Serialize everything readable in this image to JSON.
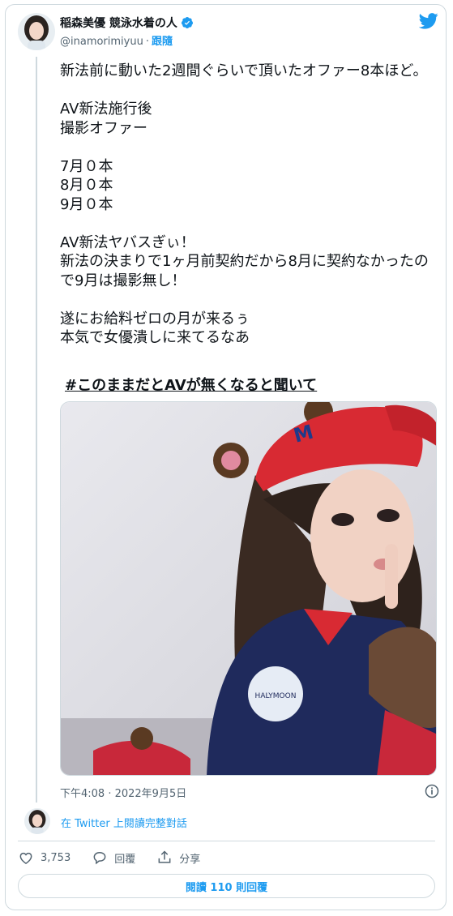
{
  "author": {
    "display_name": "稲森美優 競泳水着の人",
    "handle": "@inamorimiyuu",
    "separator": "·",
    "follow_label": "跟隨"
  },
  "tweet": {
    "text": "新法前に動いた2週間ぐらいで頂いたオファー8本ほど。\n\nAV新法施行後\n撮影オファー\n\n7月０本\n8月０本\n9月０本\n\nAV新法ヤバスぎぃ！\n新法の決まりで1ヶ月前契約だから8月に契約なかったので9月は撮影無し！\n\n遂にお給料ゼロの月が来るぅ\n本気で女優潰しに来てるなあ",
    "hashtag": "#このままだとAVが無くなると聞いて",
    "timestamp": "下午4:08 · 2022年9月5日"
  },
  "thread_link": "在 Twitter 上閱讀完整對話",
  "actions": {
    "likes": "3,753",
    "reply_label": "回覆",
    "share_label": "分享"
  },
  "read_replies_label": "閱讀 110 則回覆",
  "colors": {
    "accent": "#1d9bf0",
    "text": "#0f1419",
    "muted": "#536471",
    "border": "#cfd9de"
  },
  "icons": [
    "verified-badge-icon",
    "twitter-bird-icon",
    "info-icon",
    "heart-icon",
    "reply-icon",
    "share-icon"
  ]
}
